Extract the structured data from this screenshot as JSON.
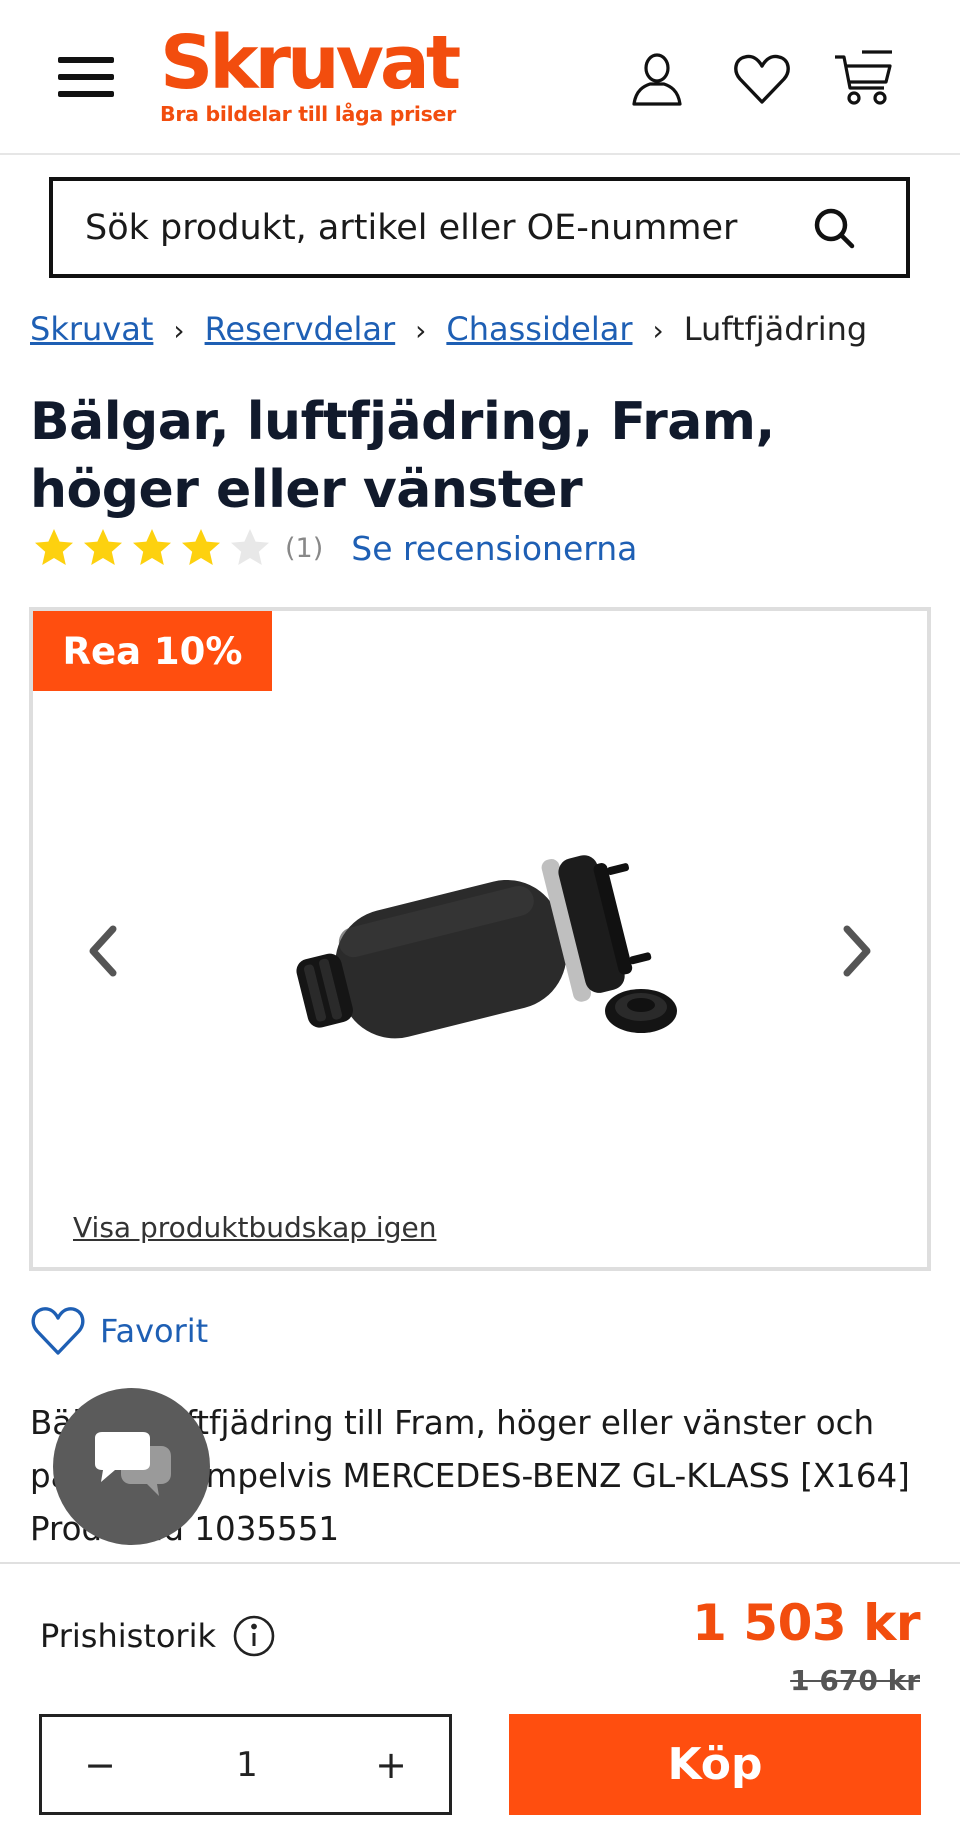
{
  "header": {
    "logo_text": "Skruvat",
    "logo_tagline": "Bra bildelar till låga priser",
    "icons": [
      "menu-icon",
      "user-icon",
      "heart-icon",
      "cart-icon"
    ]
  },
  "search": {
    "placeholder": "Sök produkt, artikel eller OE-nummer",
    "value": ""
  },
  "breadcrumb": {
    "items": [
      "Skruvat",
      "Reservdelar",
      "Chassidelar",
      "Luftfjädring"
    ],
    "separator": "›"
  },
  "product": {
    "title": "Bälgar, luftfjädring, Fram, höger eller vänster",
    "rating": {
      "stars": 4,
      "max": 5,
      "count_label": "(1)"
    },
    "reviews_link": "Se recensionerna",
    "sale_badge": "Rea 10%",
    "gallery_link": "Visa produktbudskap igen",
    "favorite_label": "Favorit",
    "description": "Bälgar, luftfjädring till Fram, höger eller vänster och passar exempelvis MERCEDES-BENZ GL-KLASS [X164] Produktid 1035551"
  },
  "purchase": {
    "price_history_label": "Prishistorik",
    "price": "1 503 kr",
    "old_price": "1 670 kr",
    "quantity": "1",
    "minus_label": "−",
    "plus_label": "+",
    "buy_label": "Köp"
  },
  "colors": {
    "brand": "#f24d0e",
    "link": "#1e5fb4",
    "star": "#fdd10f",
    "star_empty": "#e8e8e8"
  }
}
